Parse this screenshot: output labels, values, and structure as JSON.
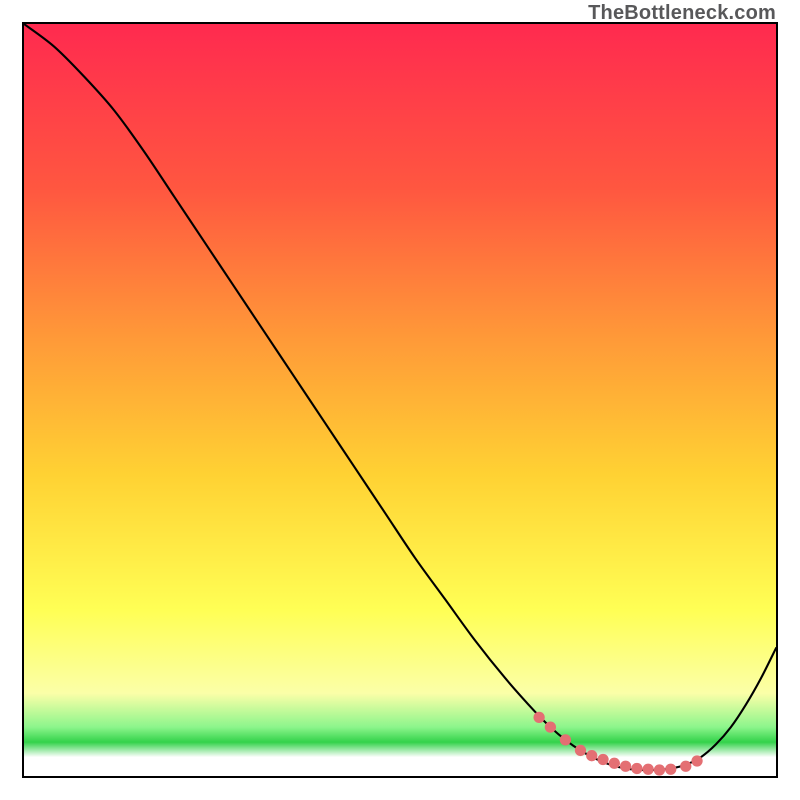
{
  "watermark": "TheBottleneck.com",
  "colors": {
    "border": "#000000",
    "line": "#000000",
    "marker": "#e46f73",
    "gradient_top": "#ff2a4f",
    "gradient_mid_upper": "#ff8a3b",
    "gradient_mid": "#ffd233",
    "gradient_mid_lower": "#ffff66",
    "gradient_green": "#4be24b",
    "gradient_bottom": "#ffffff"
  },
  "chart_data": {
    "type": "line",
    "title": "",
    "xlabel": "",
    "ylabel": "",
    "xlim": [
      0,
      100
    ],
    "ylim": [
      0,
      100
    ],
    "series": [
      {
        "name": "curve",
        "x": [
          0,
          4,
          8,
          12,
          16,
          20,
          24,
          28,
          32,
          36,
          40,
          44,
          48,
          52,
          56,
          60,
          64,
          68,
          70,
          72,
          74,
          76,
          78,
          80,
          82,
          84,
          86,
          88,
          90,
          92,
          94,
          96,
          98,
          100
        ],
        "y": [
          100,
          97,
          93,
          88.5,
          83,
          77,
          71,
          65,
          59,
          53,
          47,
          41,
          35,
          29,
          23.5,
          18,
          13,
          8.5,
          6.5,
          4.8,
          3.4,
          2.3,
          1.5,
          1.0,
          0.8,
          0.8,
          1.0,
          1.5,
          2.5,
          4.2,
          6.5,
          9.5,
          13.0,
          17.0
        ]
      }
    ],
    "dotted_segment_x": [
      68,
      90
    ],
    "marker_points": {
      "x": [
        68.5,
        70,
        72,
        74,
        75.5,
        77,
        78.5,
        80,
        81.5,
        83,
        84.5,
        86,
        88,
        89.5
      ],
      "y": [
        7.8,
        6.5,
        4.8,
        3.4,
        2.7,
        2.2,
        1.7,
        1.3,
        1.0,
        0.9,
        0.8,
        0.9,
        1.3,
        2.0
      ]
    },
    "gradient_stops": [
      {
        "pos": 0.0,
        "color": "#ff2a4f"
      },
      {
        "pos": 0.22,
        "color": "#ff5740"
      },
      {
        "pos": 0.42,
        "color": "#ff9a38"
      },
      {
        "pos": 0.6,
        "color": "#ffd233"
      },
      {
        "pos": 0.78,
        "color": "#ffff55"
      },
      {
        "pos": 0.89,
        "color": "#fbffa8"
      },
      {
        "pos": 0.935,
        "color": "#8cf58c"
      },
      {
        "pos": 0.955,
        "color": "#33d24a"
      },
      {
        "pos": 0.975,
        "color": "#ffffff"
      },
      {
        "pos": 1.0,
        "color": "#ffffff"
      }
    ]
  }
}
